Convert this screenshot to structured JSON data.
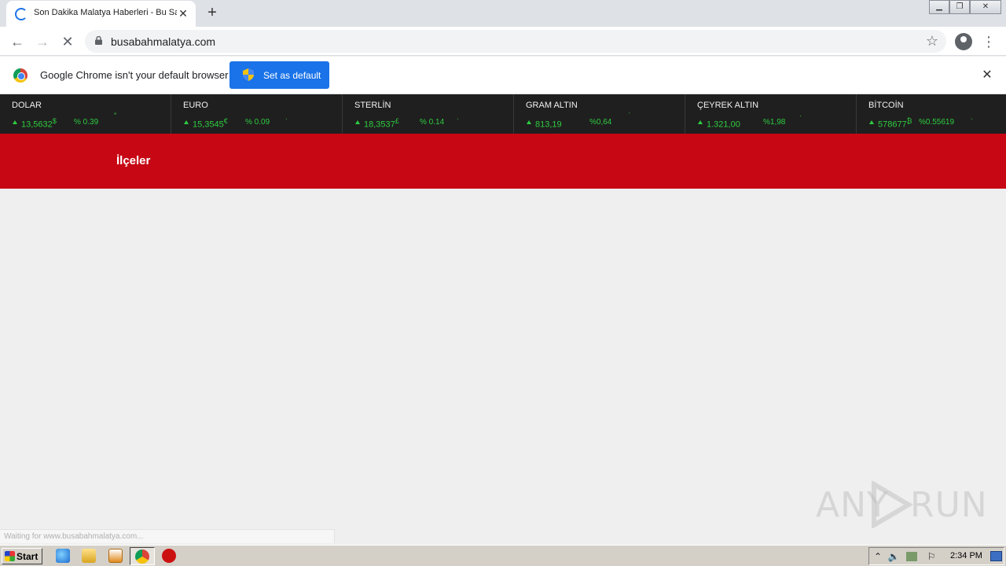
{
  "browser": {
    "tab_title": "Son Dakika Malatya Haberleri - Bu Sabah",
    "tab_close": "✕",
    "new_tab": "+",
    "url": "busabahmalatya.com",
    "back": "←",
    "forward": "→",
    "stop": "✕",
    "star": "☆",
    "menu": "⋮",
    "window_controls": {
      "minimize": "▁",
      "restore": "❐",
      "close": "✕"
    }
  },
  "infobar": {
    "message": "Google Chrome isn't your default browser",
    "button": "Set as default",
    "close": "✕"
  },
  "ticker": [
    {
      "name": "DOLAR",
      "price": "13,5632",
      "symbol": "$",
      "change": "% 0.39"
    },
    {
      "name": "EURO",
      "price": "15,3545",
      "symbol": "€",
      "change": "% 0.09"
    },
    {
      "name": "STERLİN",
      "price": "18,3537",
      "symbol": "£",
      "change": "% 0.14"
    },
    {
      "name": "GRAM ALTIN",
      "price": "813,19",
      "symbol": "",
      "change": "%0,64"
    },
    {
      "name": "ÇEYREK ALTIN",
      "price": "1.321,00",
      "symbol": "",
      "change": "%1,98"
    },
    {
      "name": "BİTCOİN",
      "price": "578677",
      "symbol": "₿",
      "change": "%0.55619"
    }
  ],
  "nav": {
    "ilceler": "İlçeler"
  },
  "status_bar": "Waiting for www.busabahmalatya.com...",
  "watermark": {
    "left": "ANY",
    "right": "RUN"
  },
  "taskbar": {
    "start": "Start",
    "clock": "2:34 PM"
  },
  "colors": {
    "accent": "#c70814",
    "ticker_bg": "#1f1f1f",
    "ticker_up": "#2ecc40",
    "chrome_blue": "#1a73e8"
  }
}
